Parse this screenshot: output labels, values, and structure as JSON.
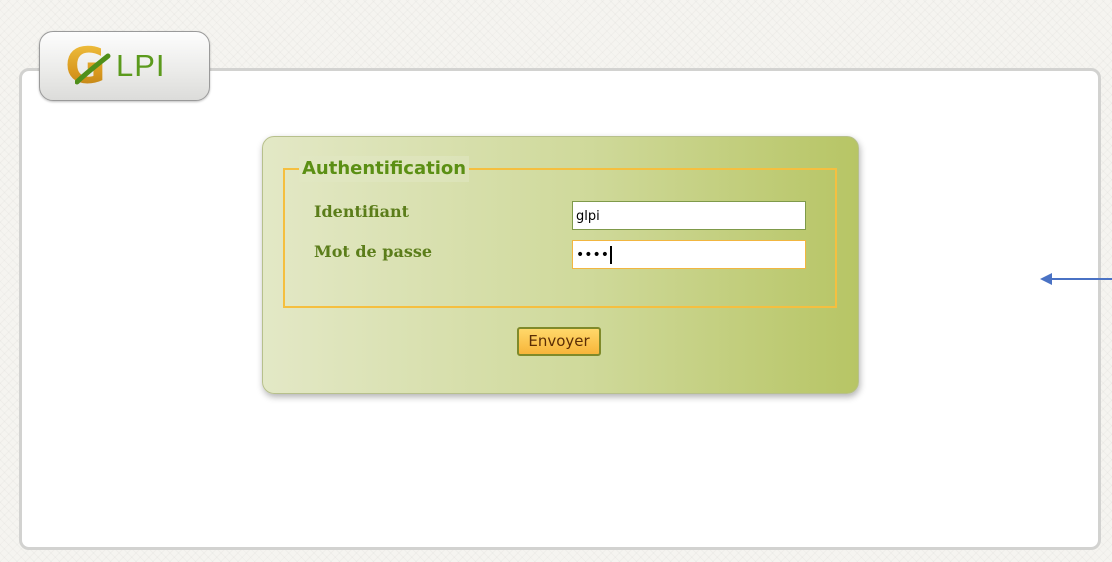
{
  "logo": {
    "initial": "G",
    "wordmark": "LPI"
  },
  "login_form": {
    "legend": "Authentification",
    "login_label": "Identifiant",
    "login_value": "glpi",
    "password_label": "Mot de passe",
    "password_masked": "••••",
    "submit_label": "Envoyer"
  },
  "colors": {
    "brand_green": "#5b9a1c",
    "brand_gold": "#e0a826",
    "fieldset_border": "#f5bf3f",
    "button_fill": "#f7b53a",
    "annotation_arrow": "#4a72c4"
  },
  "icons": {
    "annotation": "arrow-left-icon"
  }
}
